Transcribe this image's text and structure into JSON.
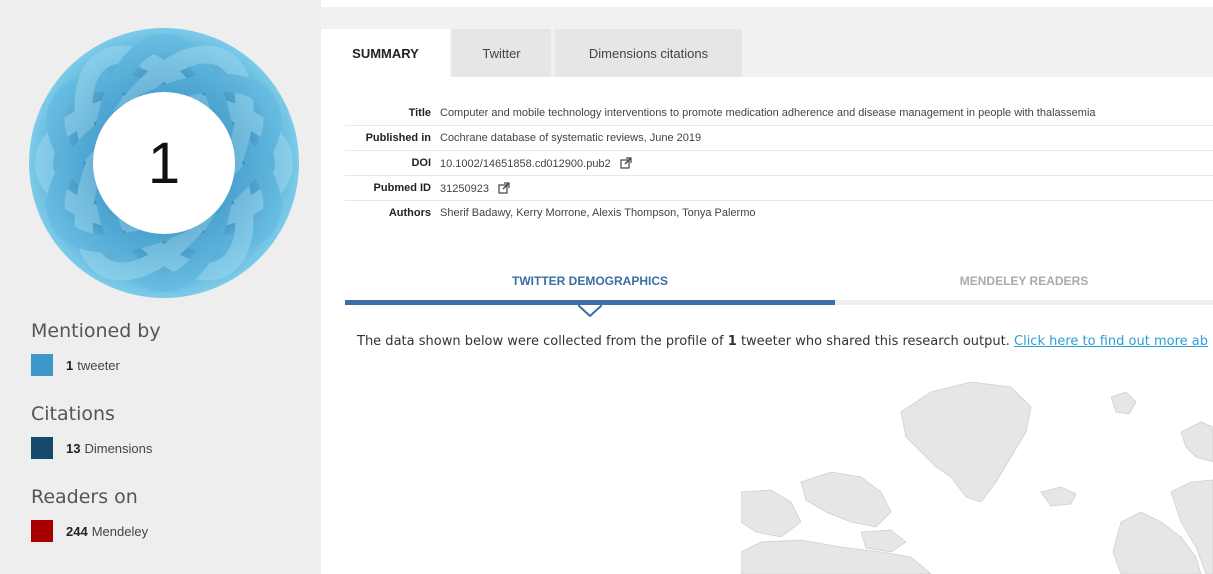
{
  "badge": {
    "score": "1",
    "colors": {
      "ring_light": "#7ccbea",
      "ring_mid": "#4aa9d6",
      "ring_dark": "#2f86b8"
    }
  },
  "sidebar": {
    "mentioned": {
      "title": "Mentioned by",
      "items": [
        {
          "count": "1",
          "label": "tweeter",
          "color": "#3d97c9"
        }
      ]
    },
    "citations": {
      "title": "Citations",
      "items": [
        {
          "count": "13",
          "label": "Dimensions",
          "color": "#17496b"
        }
      ]
    },
    "readers": {
      "title": "Readers on",
      "items": [
        {
          "count": "244",
          "label": "Mendeley",
          "color": "#a80000"
        }
      ]
    }
  },
  "tabs": [
    {
      "label": "SUMMARY",
      "active": true
    },
    {
      "label": "Twitter",
      "active": false
    },
    {
      "label": "Dimensions citations",
      "active": false
    }
  ],
  "summary": {
    "rows": [
      {
        "key": "Title",
        "value": "Computer and mobile technology interventions to promote medication adherence and disease management in people with thalassemia"
      },
      {
        "key": "Published in",
        "value": "Cochrane database of systematic reviews, June 2019"
      },
      {
        "key": "DOI",
        "value": "10.1002/14651858.cd012900.pub2",
        "external_icon": "external-link-icon"
      },
      {
        "key": "Pubmed ID",
        "value": "31250923",
        "external_icon": "external-link-icon"
      },
      {
        "key": "Authors",
        "value": "Sherif Badawy, Kerry Morrone, Alexis Thompson, Tonya Palermo"
      }
    ]
  },
  "subtabs": [
    {
      "label": "TWITTER DEMOGRAPHICS",
      "active": true
    },
    {
      "label": "MENDELEY READERS",
      "active": false
    }
  ],
  "note": {
    "prefix": "The data shown below were collected from the profile of ",
    "count": "1",
    "suffix": " tweeter who shared this research output. ",
    "link": "Click here to find out more ab"
  },
  "colors": {
    "accent": "#3a6ea5",
    "link": "#2a9fd6",
    "map_land": "#e6e6e6"
  }
}
